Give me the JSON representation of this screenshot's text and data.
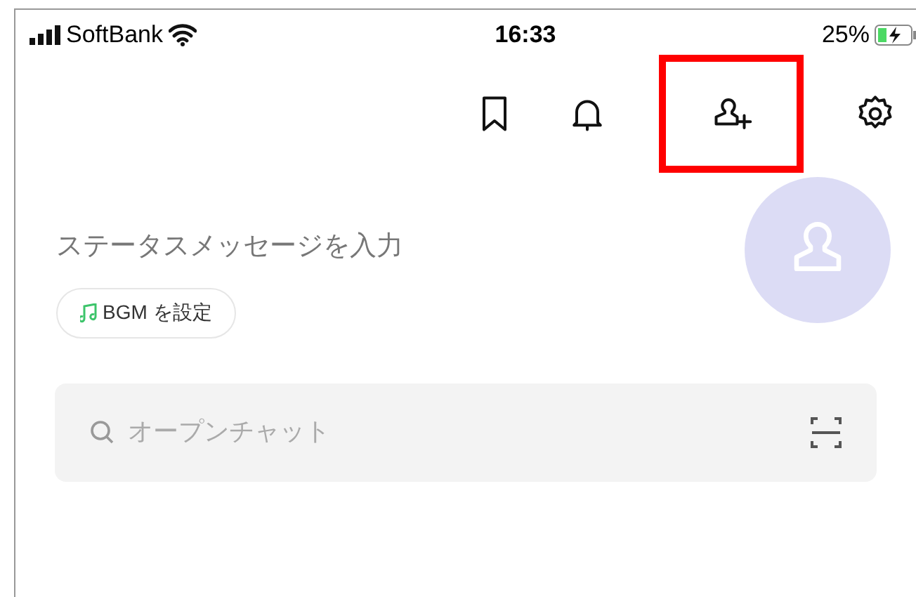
{
  "status_bar": {
    "carrier": "SoftBank",
    "time": "16:33",
    "battery": "25%"
  },
  "toolbar": [
    {
      "kind": "bookmark",
      "highlighted": false
    },
    {
      "kind": "bell",
      "highlighted": false
    },
    {
      "kind": "add-friend",
      "highlighted": true
    },
    {
      "kind": "settings",
      "highlighted": false
    }
  ],
  "profile": {
    "status_placeholder": "ステータスメッセージを入力",
    "bgm_button": "BGM を設定"
  },
  "search": {
    "placeholder": "オープンチャット"
  }
}
